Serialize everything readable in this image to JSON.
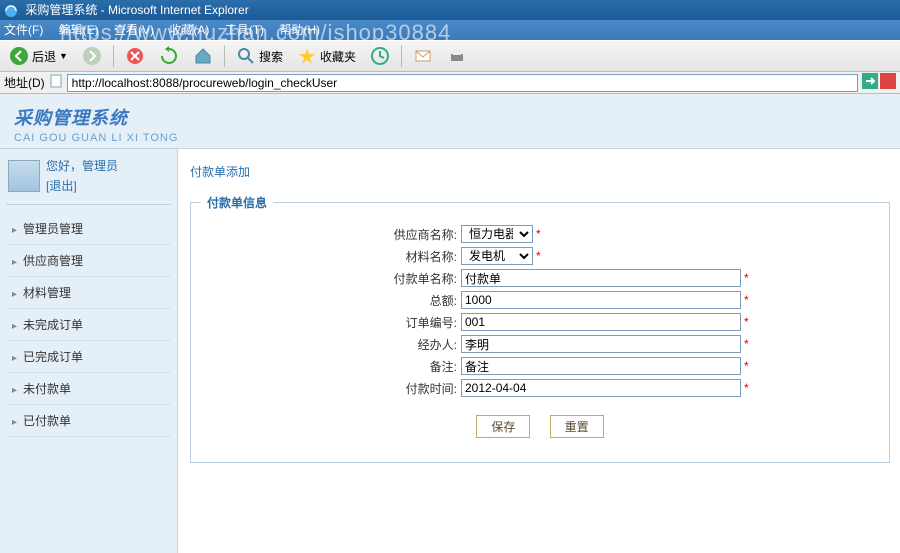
{
  "window": {
    "title": "采购管理系统 - Microsoft Internet Explorer"
  },
  "watermark": "https://www.huzhan.com/ishop30884",
  "menubar": [
    "文件(F)",
    "编辑(E)",
    "查看(V)",
    "收藏(A)",
    "工具(T)",
    "帮助(H)"
  ],
  "toolbar": {
    "back": "后退",
    "search": "搜索",
    "favs": "收藏夹"
  },
  "addressbar": {
    "label": "地址(D)",
    "url": "http://localhost:8088/procureweb/login_checkUser"
  },
  "header": {
    "zh": "采购管理系统",
    "en": "CAI GOU GUAN LI XI TONG"
  },
  "user": {
    "greet": "您好，管理员",
    "logout": "[退出]"
  },
  "nav": [
    "管理员管理",
    "供应商管理",
    "材料管理",
    "未完成订单",
    "已完成订单",
    "未付款单",
    "已付款单"
  ],
  "crumb": "付款单添加",
  "legend": "付款单信息",
  "form": {
    "supplierLabel": "供应商名称:",
    "supplierValue": "恒力电器",
    "materialLabel": "材料名称:",
    "materialValue": "发电机",
    "billNameLabel": "付款单名称:",
    "billNameValue": "付款单",
    "totalLabel": "总额:",
    "totalValue": "1000",
    "orderNoLabel": "订单编号:",
    "orderNoValue": "001",
    "handlerLabel": "经办人:",
    "handlerValue": "李明",
    "remarkLabel": "备注:",
    "remarkValue": "备注",
    "payTimeLabel": "付款时间:",
    "payTimeValue": "2012-04-04"
  },
  "buttons": {
    "save": "保存",
    "reset": "重置"
  }
}
